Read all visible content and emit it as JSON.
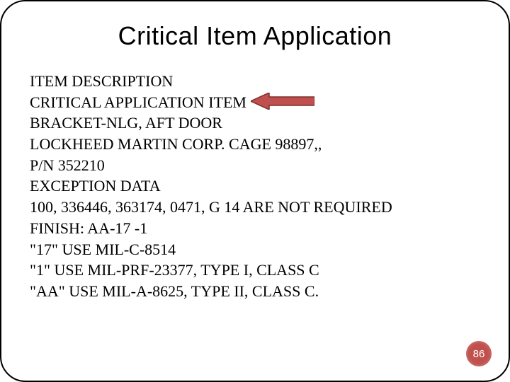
{
  "title": "Critical Item Application",
  "lines": [
    "ITEM DESCRIPTION",
    "CRITICAL APPLICATION ITEM",
    "BRACKET-NLG, AFT DOOR",
    "LOCKHEED MARTIN CORP. CAGE 98897,,",
    "P/N 352210",
    "EXCEPTION DATA",
    "100, 336446, 363174, 0471, G 14 ARE NOT REQUIRED",
    "FINISH: AA-17 -1",
    "\"17\" USE MIL-C-8514",
    "\"1\" USE MIL-PRF-23377, TYPE I, CLASS C",
    "\"AA\" USE MIL-A-8625, TYPE II, CLASS C."
  ],
  "page_number": "86",
  "arrow": {
    "semantic": "left-arrow-callout",
    "fill": "#c0504d",
    "stroke": "#7a2e2c"
  }
}
